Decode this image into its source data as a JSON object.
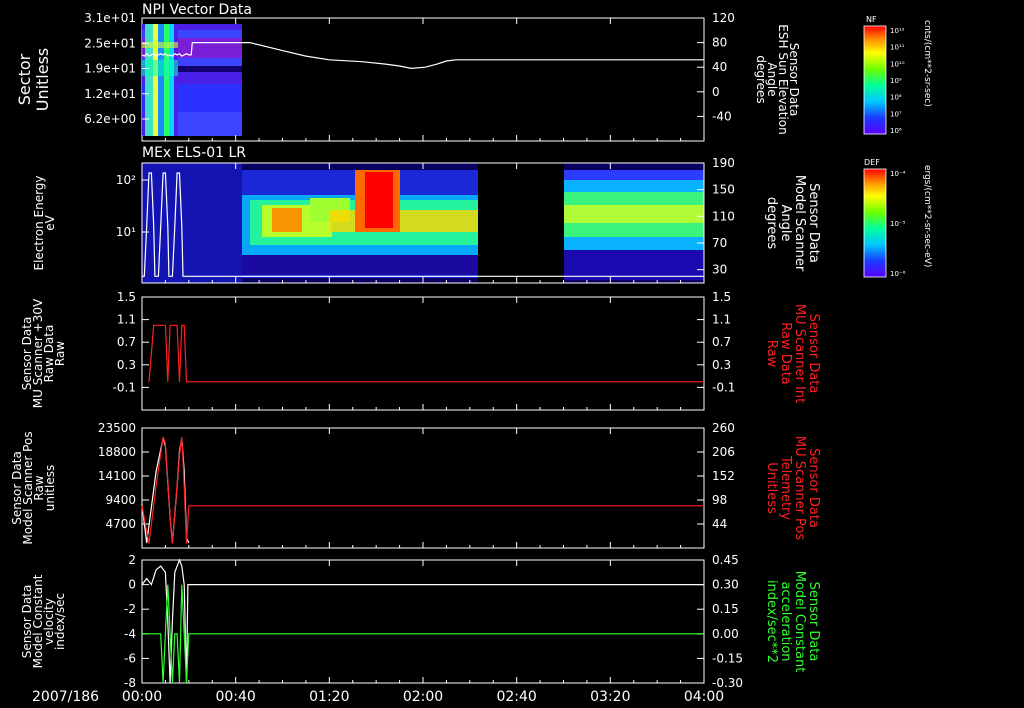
{
  "date_label": "2007/186",
  "time_axis": {
    "ticks": [
      "00:00",
      "00:40",
      "01:20",
      "02:00",
      "02:40",
      "03:20",
      "04:00"
    ],
    "range_minutes": [
      0,
      240
    ],
    "minor_ticks_per_major": 4
  },
  "colors": {
    "background": "#000000",
    "axes": "#ffffff",
    "white_trace": "#ffffff",
    "red_trace": "#ff2020",
    "green_trace": "#30ff30",
    "red_label": "#ff2020",
    "green_label": "#30ff30"
  },
  "colorbars": [
    {
      "label": "NF",
      "unit": "cnts/(cm**2-sr-sec)",
      "ticks": [
        "10¹²",
        "10¹¹",
        "10¹⁰",
        "10⁹",
        "10⁸",
        "10⁷",
        "10⁶"
      ]
    },
    {
      "label": "DEF",
      "unit": "ergs/(cm**2-sr-sec-eV)",
      "ticks": [
        "10⁻⁴",
        "10⁻⁵",
        "10⁻⁶"
      ]
    }
  ],
  "chart_data": [
    {
      "type": "heatmap",
      "title": "NPI Vector Data",
      "ylabel_left": [
        "Sector",
        "Unitless"
      ],
      "yticks_left": [
        "3.1e+01",
        "2.5e+01",
        "1.9e+01",
        "1.2e+01",
        "6.2e+00"
      ],
      "ylabel_right": [
        "Sensor Data",
        "ESH Sun Elevation",
        "Angle",
        "degrees"
      ],
      "yticks_right": [
        "120",
        "80",
        "40",
        "0",
        "-40"
      ],
      "ylim_right": [
        -80,
        120
      ],
      "heatmap_time_range_minutes": [
        0,
        21
      ],
      "series": [
        {
          "color": "white",
          "points": [
            [
              0,
              60
            ],
            [
              1,
              58
            ],
            [
              2,
              62
            ],
            [
              3,
              58
            ],
            [
              4,
              60
            ],
            [
              5,
              62
            ],
            [
              6,
              58
            ],
            [
              7,
              60
            ],
            [
              8,
              62
            ],
            [
              9,
              60
            ],
            [
              10,
              62
            ],
            [
              11,
              58
            ],
            [
              12,
              60
            ],
            [
              13,
              58
            ],
            [
              14,
              62
            ],
            [
              15,
              60
            ],
            [
              16,
              62
            ],
            [
              17,
              58
            ],
            [
              18,
              60
            ],
            [
              19,
              62
            ],
            [
              20,
              60
            ],
            [
              21,
              60
            ],
            [
              21.5,
              80
            ],
            [
              46,
              80
            ],
            [
              60,
              67
            ],
            [
              70,
              58
            ],
            [
              80,
              52
            ],
            [
              94,
              49
            ],
            [
              104,
              45
            ],
            [
              110,
              42
            ],
            [
              115,
              38
            ],
            [
              121,
              40
            ],
            [
              126,
              45
            ],
            [
              130,
              50
            ],
            [
              134,
              52
            ],
            [
              240,
              52
            ]
          ]
        }
      ]
    },
    {
      "type": "heatmap",
      "title": "MEx ELS-01 LR",
      "ylabel_left": [
        "Electron Energy",
        "eV"
      ],
      "yticks_left": [
        "10²",
        "10¹"
      ],
      "ylabel_right": [
        "Sensor Data",
        "Model Scanner",
        "Angle",
        "degrees"
      ],
      "yticks_right": [
        "190",
        "150",
        "110",
        "70",
        "30"
      ],
      "ylim_right": [
        10,
        190
      ],
      "data_gap_minutes": [
        142,
        178
      ],
      "series": [
        {
          "color": "white",
          "points": [
            [
              0,
              20
            ],
            [
              1,
              20
            ],
            [
              2,
              95
            ],
            [
              3,
              175
            ],
            [
              4,
              175
            ],
            [
              5,
              95
            ],
            [
              5.5,
              20
            ],
            [
              7,
              20
            ],
            [
              8,
              95
            ],
            [
              9,
              175
            ],
            [
              10,
              175
            ],
            [
              11,
              95
            ],
            [
              11.5,
              20
            ],
            [
              13,
              20
            ],
            [
              14,
              95
            ],
            [
              15,
              175
            ],
            [
              16,
              175
            ],
            [
              17,
              95
            ],
            [
              17.5,
              20
            ],
            [
              240,
              20
            ]
          ]
        }
      ]
    },
    {
      "type": "line",
      "ylabel_left": [
        "Sensor Data",
        "MU Scanner +30V",
        "Raw Data",
        "Raw"
      ],
      "yticks_left": [
        "1.5",
        "1.1",
        "0.7",
        "0.3",
        "-0.1"
      ],
      "ylim_left": [
        -0.5,
        1.5
      ],
      "ylabel_right": [
        "Sensor Data",
        "MU Scanner Int",
        "Raw Data",
        "Raw"
      ],
      "yticks_right": [
        "1.5",
        "1.1",
        "0.7",
        "0.3",
        "-0.1"
      ],
      "ylim_right": [
        -0.5,
        1.5
      ],
      "series": [
        {
          "color": "red",
          "points": [
            [
              3,
              0
            ],
            [
              5,
              1
            ],
            [
              10,
              1
            ],
            [
              11,
              0
            ],
            [
              12,
              1
            ],
            [
              15,
              1
            ],
            [
              16,
              0
            ],
            [
              17,
              1
            ],
            [
              18,
              1
            ],
            [
              19,
              0
            ],
            [
              240,
              0
            ]
          ]
        }
      ]
    },
    {
      "type": "line",
      "ylabel_left": [
        "Sensor Data",
        "Model Scanner Pos",
        "Raw",
        "unitless"
      ],
      "yticks_left": [
        "23500",
        "18800",
        "14100",
        "9400",
        "4700"
      ],
      "ylim_left": [
        0,
        23500
      ],
      "ylabel_right": [
        "Sensor Data",
        "MU Scanner Pos",
        "Telemetry",
        "Unitless"
      ],
      "yticks_right": [
        "260",
        "206",
        "152",
        "98",
        "44"
      ],
      "ylim_right": [
        -10,
        260
      ],
      "series": [
        {
          "color": "white",
          "points": [
            [
              0,
              8500
            ],
            [
              2,
              1000
            ],
            [
              4,
              8000
            ],
            [
              6,
              15000
            ],
            [
              9,
              21500
            ],
            [
              10,
              20000
            ],
            [
              12,
              6000
            ],
            [
              13,
              1000
            ],
            [
              15,
              12000
            ],
            [
              16,
              19000
            ],
            [
              17,
              21500
            ],
            [
              18,
              15000
            ],
            [
              19,
              2000
            ],
            [
              20,
              1000
            ]
          ]
        },
        {
          "color": "red",
          "points": [
            [
              0,
              85
            ],
            [
              3,
              0
            ],
            [
              6,
              130
            ],
            [
              9,
              240
            ],
            [
              10,
              225
            ],
            [
              12,
              60
            ],
            [
              13,
              0
            ],
            [
              16,
              200
            ],
            [
              17,
              240
            ],
            [
              18,
              130
            ],
            [
              19,
              0
            ],
            [
              20,
              85
            ],
            [
              240,
              85
            ]
          ]
        }
      ]
    },
    {
      "type": "line",
      "ylabel_left": [
        "Sensor Data",
        "Model Constant",
        "velocity",
        "index/sec"
      ],
      "yticks_left": [
        "2",
        "0",
        "-2",
        "-4",
        "-6",
        "-8"
      ],
      "ylim_left": [
        -8,
        2
      ],
      "ylabel_right": [
        "Sensor Data",
        "Model Constant",
        "acceleration",
        "index/sec**2"
      ],
      "yticks_right": [
        "0.45",
        "0.30",
        "0.15",
        "0.00",
        "-0.15",
        "-0.30"
      ],
      "ylim_right": [
        -0.3,
        0.45
      ],
      "series": [
        {
          "color": "white",
          "points": [
            [
              0,
              0
            ],
            [
              2,
              0.5
            ],
            [
              4,
              0
            ],
            [
              6,
              1.2
            ],
            [
              8,
              1.5
            ],
            [
              10,
              1
            ],
            [
              11,
              -3
            ],
            [
              12,
              -8
            ],
            [
              13,
              -3
            ],
            [
              14,
              1
            ],
            [
              16,
              2
            ],
            [
              17,
              1.5
            ],
            [
              18,
              0
            ],
            [
              19,
              -8
            ],
            [
              19.6,
              0
            ],
            [
              240,
              0
            ]
          ]
        },
        {
          "color": "green",
          "points": [
            [
              0,
              0
            ],
            [
              8,
              0
            ],
            [
              9,
              -0.3
            ],
            [
              10,
              0
            ],
            [
              11,
              0.3
            ],
            [
              12,
              0
            ],
            [
              13,
              -0.3
            ],
            [
              14,
              0
            ],
            [
              15,
              0
            ],
            [
              16,
              -0.3
            ],
            [
              17,
              0.3
            ],
            [
              18,
              0
            ],
            [
              19,
              -0.3
            ],
            [
              20,
              0
            ],
            [
              240,
              0
            ]
          ]
        }
      ]
    }
  ]
}
